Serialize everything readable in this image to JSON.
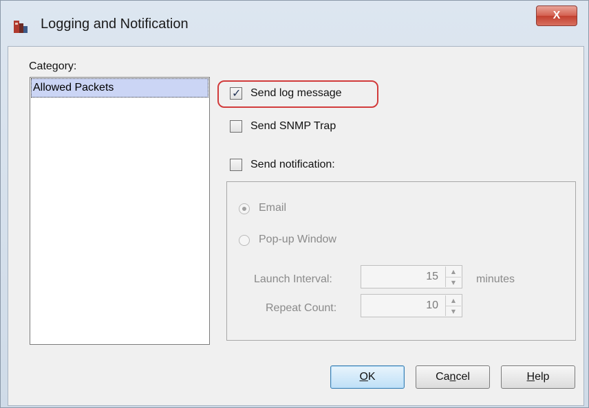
{
  "window": {
    "title": "Logging and Notification",
    "close_glyph": "X"
  },
  "category": {
    "label": "Category:",
    "items": [
      "Allowed Packets"
    ]
  },
  "options": {
    "send_log": {
      "label": "Send log message",
      "checked": true
    },
    "send_snmp": {
      "label": "Send SNMP Trap",
      "checked": false
    },
    "send_notification": {
      "label": "Send notification:",
      "checked": false
    }
  },
  "notification": {
    "email_label": "Email",
    "popup_label": "Pop-up Window",
    "selected": "Email",
    "launch_interval_label": "Launch Interval:",
    "launch_interval_value": "15",
    "launch_interval_unit": "minutes",
    "repeat_count_label": "Repeat Count:",
    "repeat_count_value": "10"
  },
  "buttons": {
    "ok_mnemonic": "O",
    "ok_rest": "K",
    "cancel_pre": "Ca",
    "cancel_mnemonic": "n",
    "cancel_post": "cel",
    "help_mnemonic": "H",
    "help_rest": "elp"
  },
  "icons": {
    "app": "firewall-app-icon",
    "close": "close-icon",
    "spin_up": "up-arrow-icon",
    "spin_down": "down-arrow-icon"
  },
  "colors": {
    "highlight": "#d13a3a",
    "selection": "#cbd5f5",
    "close_button": "#c2402f",
    "default_button": "#bfe0f7"
  }
}
